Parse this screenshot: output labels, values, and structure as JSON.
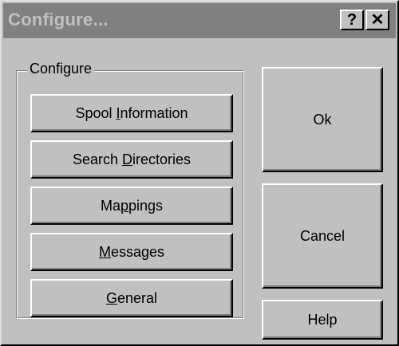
{
  "window": {
    "title": "Configure...",
    "help_glyph": "?",
    "close_glyph": "✕",
    "help_icon": "question-mark-icon",
    "close_icon": "close-x-icon"
  },
  "group": {
    "label": "Configure"
  },
  "buttons": {
    "spool": {
      "pre": "Spool ",
      "mn": "I",
      "post": "nformation"
    },
    "search": {
      "pre": "Search ",
      "mn": "D",
      "post": "irectories"
    },
    "mappings": {
      "pre": "Ma",
      "mn": "p",
      "post": "pings"
    },
    "messages": {
      "pre": "",
      "mn": "M",
      "post": "essages"
    },
    "general": {
      "pre": "",
      "mn": "G",
      "post": "eneral"
    },
    "ok": "Ok",
    "cancel": "Cancel",
    "help": "Help"
  },
  "colors": {
    "face": "#c0c0c0",
    "titlebar_inactive": "#808080",
    "titlebar_text": "#c0c0c0"
  }
}
